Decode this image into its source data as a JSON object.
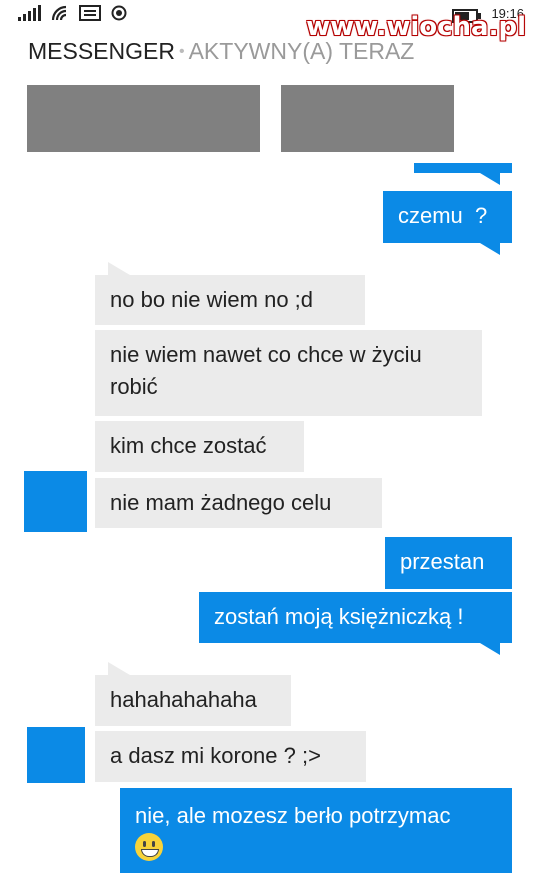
{
  "status_bar": {
    "time": "19:16",
    "icons": [
      "signal-icon",
      "wifi-icon",
      "message-icon",
      "location-icon",
      "battery-icon"
    ]
  },
  "watermark": "www.wiocha.pl",
  "header": {
    "title": "MESSENGER",
    "separator": "•",
    "status": "AKTYWNY(A) TERAZ"
  },
  "colors": {
    "outgoing": "#0b8ae6",
    "incoming": "#ebebeb",
    "redaction": "#808080"
  },
  "messages": [
    {
      "direction": "out",
      "text": ""
    },
    {
      "direction": "out",
      "text": "czemu  ?"
    },
    {
      "direction": "in",
      "text": "no bo nie wiem no ;d"
    },
    {
      "direction": "in",
      "text": "nie wiem nawet co chce w życiu robić"
    },
    {
      "direction": "in",
      "text": "kim chce zostać"
    },
    {
      "direction": "in",
      "text": "nie mam żadnego celu"
    },
    {
      "direction": "out",
      "text": "przestan"
    },
    {
      "direction": "out",
      "text": "zostań moją księżniczką !"
    },
    {
      "direction": "in",
      "text": "hahahahahaha"
    },
    {
      "direction": "in",
      "text": "a dasz mi korone ? ;>"
    },
    {
      "direction": "out",
      "text": "nie, ale mozesz berło potrzymac",
      "emoji": "grinning-face-emoji"
    }
  ]
}
